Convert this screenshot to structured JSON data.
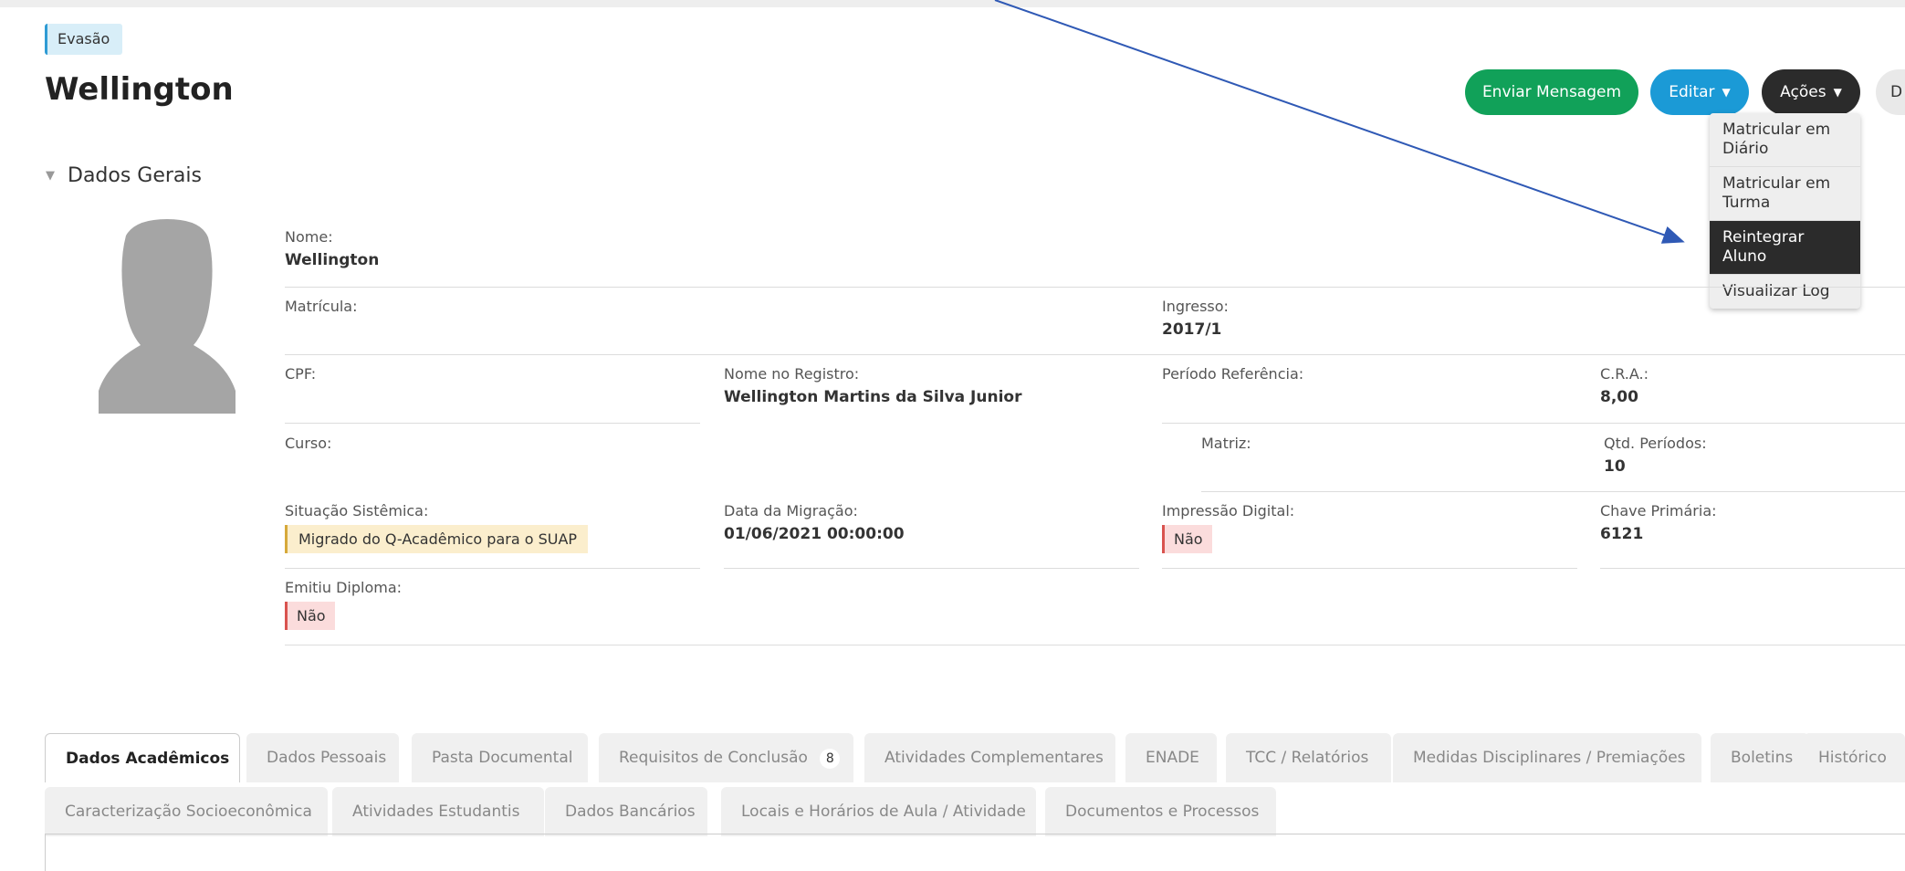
{
  "header": {
    "status_badge": "Evasão",
    "title": "Wellington"
  },
  "actions": {
    "send_message": "Enviar Mensagem",
    "edit": "Editar",
    "actions": "Ações",
    "more": "D"
  },
  "dropdown": {
    "items": [
      "Matricular em Diário",
      "Matricular em Turma",
      "Reintegrar Aluno",
      "Visualizar Log"
    ],
    "active_index": 2
  },
  "section": {
    "title": "Dados Gerais"
  },
  "fields": {
    "nome": {
      "label": "Nome:",
      "value": "Wellington"
    },
    "matricula": {
      "label": "Matrícula:",
      "value": ""
    },
    "ingresso": {
      "label": "Ingresso:",
      "value": "2017/1"
    },
    "cpf": {
      "label": "CPF:",
      "value": ""
    },
    "nome_registro": {
      "label": "Nome no Registro:",
      "value": "Wellington Martins da Silva Junior"
    },
    "periodo_ref": {
      "label": "Período Referência:",
      "value": ""
    },
    "cra": {
      "label": "C.R.A.:",
      "value": "8,00"
    },
    "curso": {
      "label": "Curso:",
      "value": ""
    },
    "matriz": {
      "label": "Matriz:",
      "value": ""
    },
    "qtd_periodos": {
      "label": "Qtd. Períodos:",
      "value": "10"
    },
    "situacao": {
      "label": "Situação Sistêmica:",
      "value": "Migrado do Q-Acadêmico para o SUAP"
    },
    "data_migracao": {
      "label": "Data da Migração:",
      "value": "01/06/2021 00:00:00"
    },
    "impressao": {
      "label": "Impressão Digital:",
      "value": "Não"
    },
    "chave": {
      "label": "Chave Primária:",
      "value": "6121"
    },
    "diploma": {
      "label": "Emitiu Diploma:",
      "value": "Não"
    }
  },
  "tabs_row1": [
    "Dados Acadêmicos",
    "Dados Pessoais",
    "Pasta Documental",
    "Requisitos de Conclusão",
    "Atividades Complementares",
    "ENADE",
    "TCC / Relatórios",
    "Medidas Disciplinares / Premiações",
    "Boletins",
    "Histórico"
  ],
  "requisitos_count": "8",
  "tabs_row2": [
    "Caracterização Socioeconômica",
    "Atividades Estudantis",
    "Dados Bancários",
    "Locais e Horários de Aula / Atividade",
    "Documentos e Processos"
  ],
  "colors": {
    "green": "#11a159",
    "blue": "#1b9ad6",
    "dark": "#2b2b2b",
    "arrow": "#2f59b5"
  },
  "icons": [
    "chevron-down-icon",
    "avatar-placeholder-icon",
    "arrow-annotation"
  ]
}
